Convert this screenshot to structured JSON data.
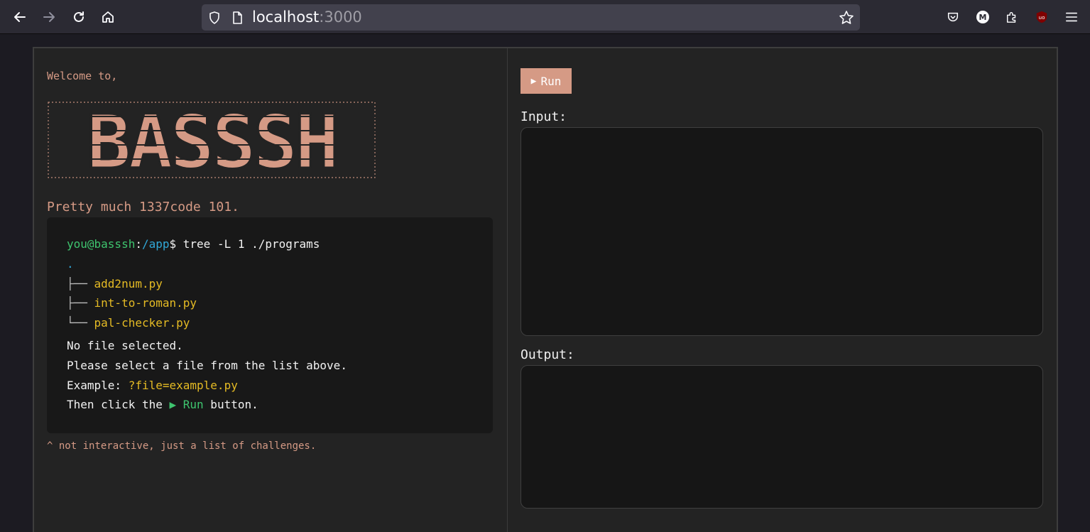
{
  "browser": {
    "url_host": "localhost",
    "url_port": ":3000",
    "icons": [
      "back-icon",
      "forward-icon",
      "reload-icon",
      "home-icon",
      "shield-icon",
      "page-icon",
      "bookmark-star-icon",
      "pocket-icon",
      "account-icon",
      "extensions-icon",
      "ublock-icon",
      "menu-icon"
    ],
    "account_initial": "M",
    "colors": {
      "toolbar": "#2b2a33",
      "urlbar": "#42414d"
    }
  },
  "left": {
    "welcome": "Welcome to,",
    "banner_text": "BASSSH",
    "tagline": "Pretty much 1337code 101.",
    "terminal": {
      "prompt_user": "you@basssh",
      "prompt_sep": ":",
      "prompt_path": "/app",
      "prompt_dollar": "$",
      "command": " tree -L 1 ./programs",
      "root": ".",
      "files": [
        {
          "branch": "├── ",
          "name": "add2num.py"
        },
        {
          "branch": "├── ",
          "name": "int-to-roman.py"
        },
        {
          "branch": "└── ",
          "name": "pal-checker.py"
        }
      ],
      "msg_no_file": "No file selected.",
      "msg_select": "Please select a file from the list above.",
      "example_label": "Example: ",
      "example_value": "?file=example.py",
      "then_prefix": "Then click the ",
      "then_button": "▶ Run",
      "then_suffix": " button."
    },
    "footnote": "^ not interactive, just a list of challenges."
  },
  "right": {
    "run_icon": "▶",
    "run_label": "Run",
    "input_label": "Input:",
    "input_value": "",
    "output_label": "Output:",
    "output_value": ""
  },
  "colors": {
    "accent": "#d59a85",
    "prompt_user": "#3ec46e",
    "prompt_path": "#31a8d8",
    "file_name": "#e5bb24",
    "panel_bg": "#232323",
    "terminal_bg": "#181818"
  }
}
